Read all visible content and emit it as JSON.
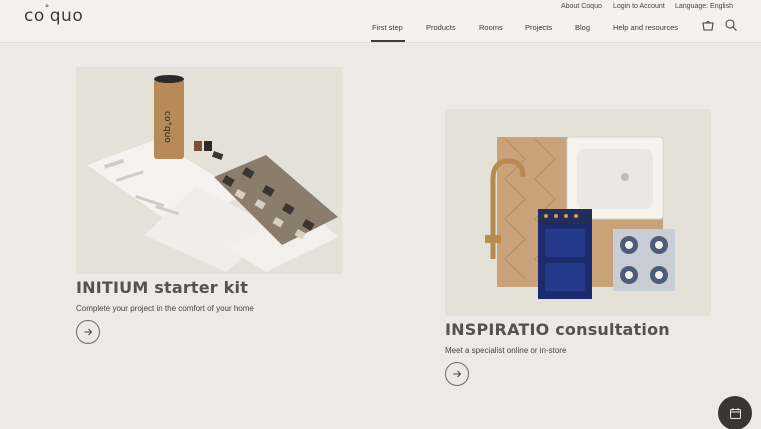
{
  "brand": {
    "logo_text": "co",
    "logo_sup": "°",
    "logo_tail": "quo"
  },
  "utility_nav": {
    "about": "About Coquo",
    "login": "Login to Account",
    "language": "Language: English"
  },
  "main_nav": {
    "items": [
      {
        "label": "First step",
        "active": true
      },
      {
        "label": "Products"
      },
      {
        "label": "Rooms"
      },
      {
        "label": "Projects"
      },
      {
        "label": "Blog"
      },
      {
        "label": "Help and resources"
      }
    ]
  },
  "header_icons": [
    "cart-icon",
    "search-icon"
  ],
  "cards": [
    {
      "title": "INITIUM starter kit",
      "subtitle": "Complete your project in the comfort of your home",
      "image_tube_text": "co°quo"
    },
    {
      "title": "INSPIRATIO consultation",
      "subtitle": "Meet a specialist online or in-store"
    }
  ],
  "fab_icon": "calendar-icon",
  "colors": {
    "page_bg": "#ebeae6",
    "header_bg": "#f3f2ef",
    "title": "#555250",
    "fab": "#3a3733"
  }
}
